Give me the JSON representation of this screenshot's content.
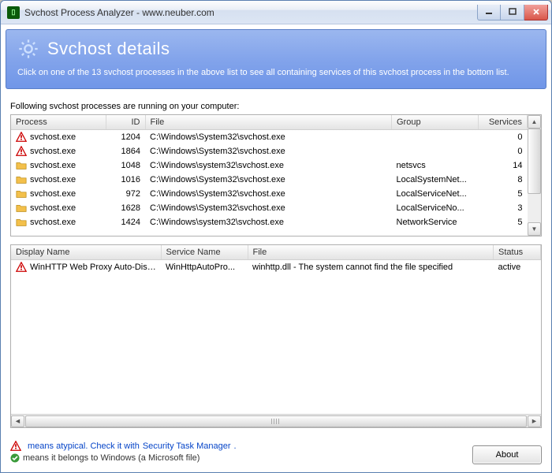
{
  "window": {
    "title": "Svchost Process Analyzer - www.neuber.com"
  },
  "banner": {
    "heading": "Svchost details",
    "subtext": "Click on one of the 13 svchost processes in the above list to see all containing services of this svchost process in the bottom list."
  },
  "caption_top": "Following svchost processes are running on your computer:",
  "proc_table": {
    "headers": {
      "process": "Process",
      "id": "ID",
      "file": "File",
      "group": "Group",
      "services": "Services"
    },
    "rows": [
      {
        "icon": "warn",
        "process": "svchost.exe",
        "id": "1204",
        "file": "C:\\Windows\\System32\\svchost.exe",
        "group": "",
        "services": "0"
      },
      {
        "icon": "warn",
        "process": "svchost.exe",
        "id": "1864",
        "file": "C:\\Windows\\System32\\svchost.exe",
        "group": "",
        "services": "0"
      },
      {
        "icon": "folder",
        "process": "svchost.exe",
        "id": "1048",
        "file": "C:\\Windows\\system32\\svchost.exe",
        "group": "netsvcs",
        "services": "14"
      },
      {
        "icon": "folder",
        "process": "svchost.exe",
        "id": "1016",
        "file": "C:\\Windows\\System32\\svchost.exe",
        "group": "LocalSystemNet...",
        "services": "8"
      },
      {
        "icon": "folder",
        "process": "svchost.exe",
        "id": "972",
        "file": "C:\\Windows\\System32\\svchost.exe",
        "group": "LocalServiceNet...",
        "services": "5"
      },
      {
        "icon": "folder",
        "process": "svchost.exe",
        "id": "1628",
        "file": "C:\\Windows\\System32\\svchost.exe",
        "group": "LocalServiceNo...",
        "services": "3"
      },
      {
        "icon": "folder",
        "process": "svchost.exe",
        "id": "1424",
        "file": "C:\\Windows\\system32\\svchost.exe",
        "group": "NetworkService",
        "services": "5"
      }
    ]
  },
  "svc_table": {
    "headers": {
      "display": "Display Name",
      "service": "Service Name",
      "file": "File",
      "status": "Status"
    },
    "rows": [
      {
        "icon": "warn",
        "display": "WinHTTP Web Proxy Auto-Disc...",
        "service": "WinHttpAutoPro...",
        "file": "winhttp.dll - The system cannot find the file specified",
        "status": "active"
      }
    ]
  },
  "footer": {
    "atypical_text": "means atypical. Check it with ",
    "atypical_link": "Security Task Manager",
    "belongs_text": "means it belongs to Windows (a Microsoft file)",
    "about_label": "About"
  }
}
